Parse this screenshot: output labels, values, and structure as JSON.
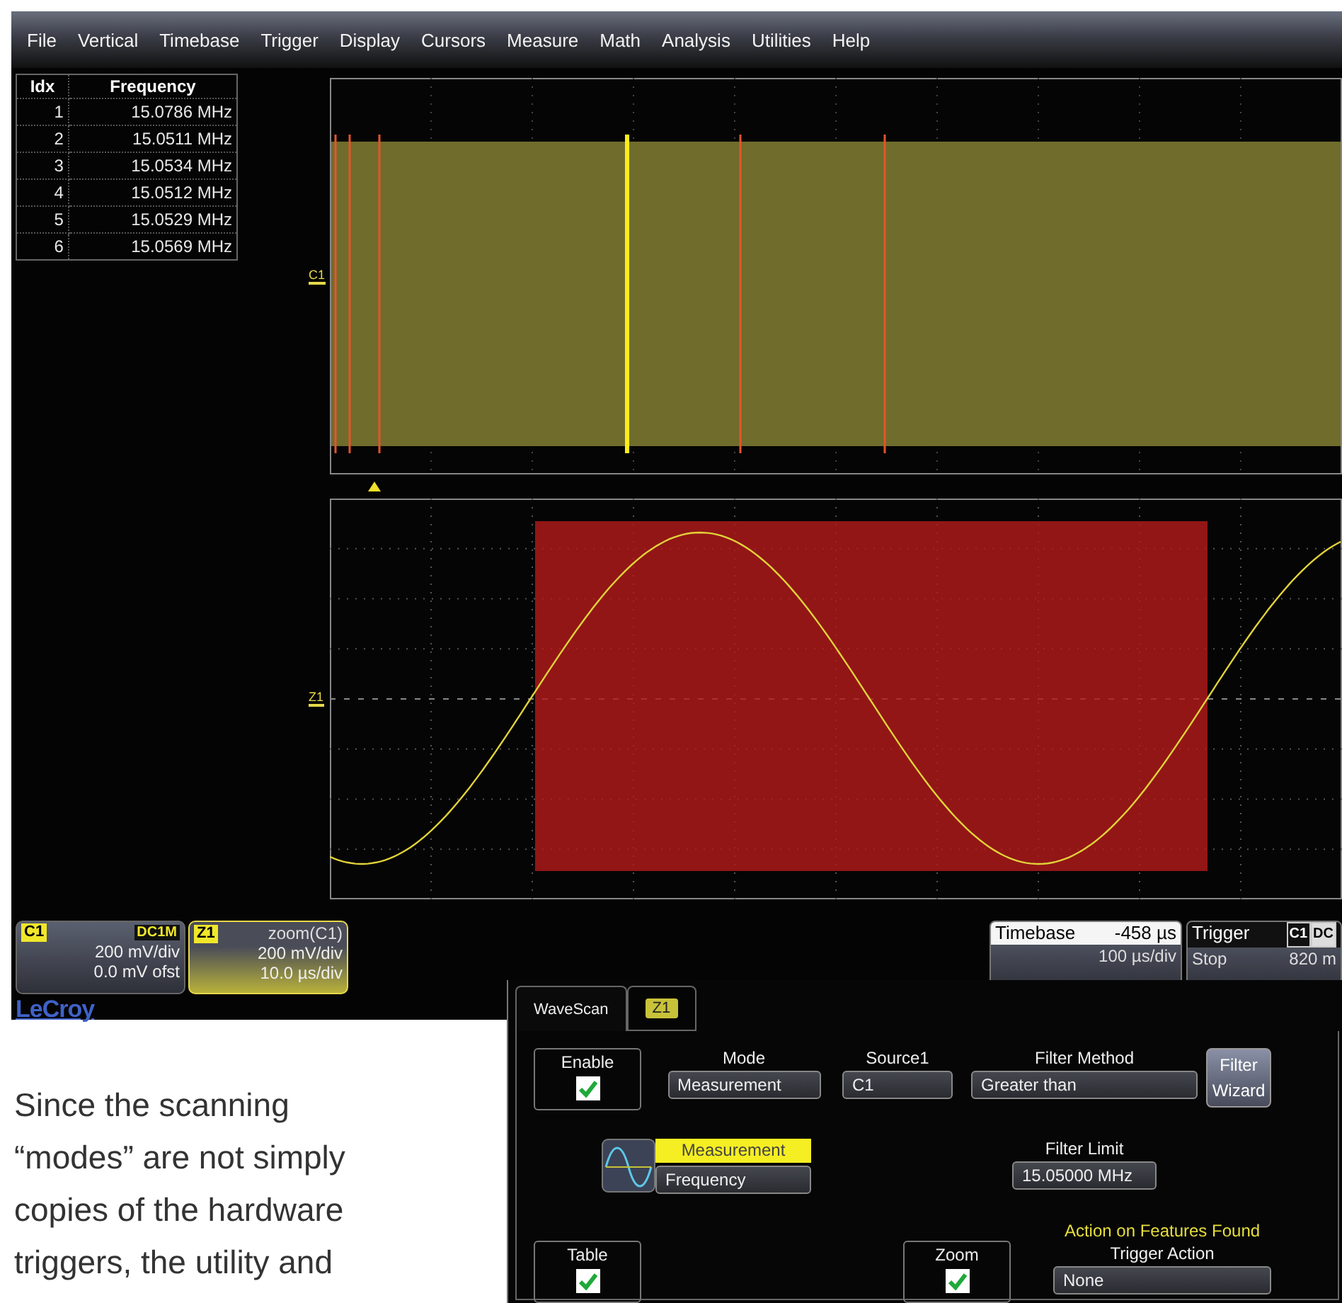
{
  "menu": [
    "File",
    "Vertical",
    "Timebase",
    "Trigger",
    "Display",
    "Cursors",
    "Measure",
    "Math",
    "Analysis",
    "Utilities",
    "Help"
  ],
  "table": {
    "columns": [
      "Idx",
      "Frequency"
    ],
    "rows": [
      [
        "1",
        "15.0786 MHz"
      ],
      [
        "2",
        "15.0511 MHz"
      ],
      [
        "3",
        "15.0534 MHz"
      ],
      [
        "4",
        "15.0512 MHz"
      ],
      [
        "5",
        "15.0529 MHz"
      ],
      [
        "6",
        "15.0569 MHz"
      ]
    ]
  },
  "upper_grid": {
    "label": "C1"
  },
  "lower_grid": {
    "label": "Z1"
  },
  "channels": [
    {
      "badge": "C1",
      "source": "DC1M",
      "source_boxed": true,
      "line_1": "200 mV/div",
      "line_2": "0.0 mV ofst",
      "selected": false
    },
    {
      "badge": "Z1",
      "source": "zoom(C1)",
      "source_boxed": false,
      "line_1": "200 mV/div",
      "line_2": "10.0 µs/div",
      "selected": true
    }
  ],
  "logo": "LeCroy",
  "timebase": {
    "title": "Timebase",
    "delay": "-458 µs",
    "scale": "100 µs/div"
  },
  "trigger": {
    "title": "Trigger",
    "source": "C1",
    "coupling": "DC",
    "mode": "Stop",
    "threshold": "820 m"
  },
  "dialog": {
    "tabs": [
      {
        "label": "WaveScan",
        "selected": true,
        "kind": "text"
      },
      {
        "label": "Z1",
        "selected": false,
        "kind": "badge"
      }
    ],
    "enable": {
      "label": "Enable",
      "checked": true
    },
    "mode": {
      "label": "Mode",
      "value": "Measurement"
    },
    "source": {
      "label": "Source1",
      "value": "C1"
    },
    "filter_method": {
      "label": "Filter Method",
      "value": "Greater than"
    },
    "filter_wizard": [
      "Filter",
      "Wizard"
    ],
    "measurement": {
      "header": "Measurement",
      "value": "Frequency"
    },
    "filter_limit": {
      "label": "Filter Limit",
      "value": "15.05000 MHz"
    },
    "table": {
      "label": "Table",
      "checked": true
    },
    "zoom": {
      "label": "Zoom",
      "checked": true
    },
    "action_heading": "Action on Features Found",
    "trigger_action": {
      "label": "Trigger Action",
      "value": "None"
    }
  },
  "body_text": [
    "Since the scanning",
    "“modes” are not simply",
    "copies of the hardware",
    "triggers, the utility and"
  ]
}
